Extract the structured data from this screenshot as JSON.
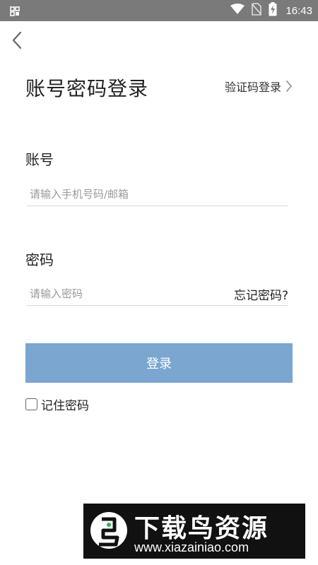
{
  "status_bar": {
    "time": "16:43",
    "icons": [
      "grid-icon",
      "wifi-icon",
      "no-sim-icon",
      "battery-charging-icon"
    ]
  },
  "header": {
    "back_icon": "chevron-left-icon",
    "title": "账号密码登录",
    "switch_link": "验证码登录"
  },
  "form": {
    "account": {
      "label": "账号",
      "placeholder": "请输入手机号码/邮箱",
      "value": ""
    },
    "password": {
      "label": "密码",
      "placeholder": "请输入密码",
      "value": "",
      "forgot_link": "忘记密码?"
    },
    "login_button": "登录",
    "remember": {
      "label": "记住密码",
      "checked": false
    }
  },
  "watermark": {
    "title": "下载鸟资源",
    "url": "www.xiazainiao.com"
  },
  "colors": {
    "status_bar": "#7a7a7a",
    "login_button": "#7aa6cf",
    "background": "#ffffff"
  }
}
